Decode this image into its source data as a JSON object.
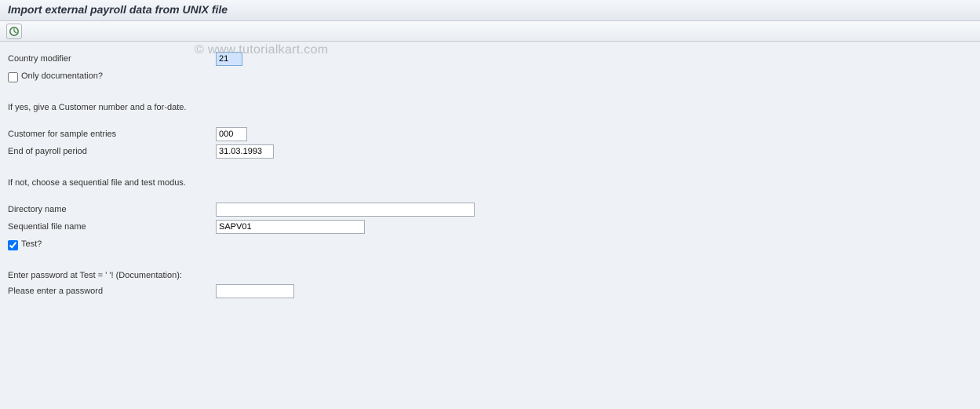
{
  "title": "Import external payroll data from UNIX file",
  "watermark": "© www.tutorialkart.com",
  "toolbar": {
    "execute_icon": "execute"
  },
  "fields": {
    "country_modifier": {
      "label": "Country modifier",
      "value": "21"
    },
    "only_documentation": {
      "label": "Only documentation?",
      "checked": false
    },
    "section1_text": "If yes, give a Customer number and a for-date.",
    "customer_sample": {
      "label": "Customer for sample entries",
      "value": "000"
    },
    "end_payroll": {
      "label": "End of payroll period",
      "value": "31.03.1993"
    },
    "section2_text": "If not, choose a sequential file and test modus.",
    "directory": {
      "label": "Directory name",
      "value": ""
    },
    "seq_file": {
      "label": "Sequential file name",
      "value": "SAPV01"
    },
    "test": {
      "label": "Test?",
      "checked": true
    },
    "section3_text": "Enter password at Test = ' '! (Documentation):",
    "password": {
      "label": "Please enter a password",
      "value": ""
    }
  }
}
